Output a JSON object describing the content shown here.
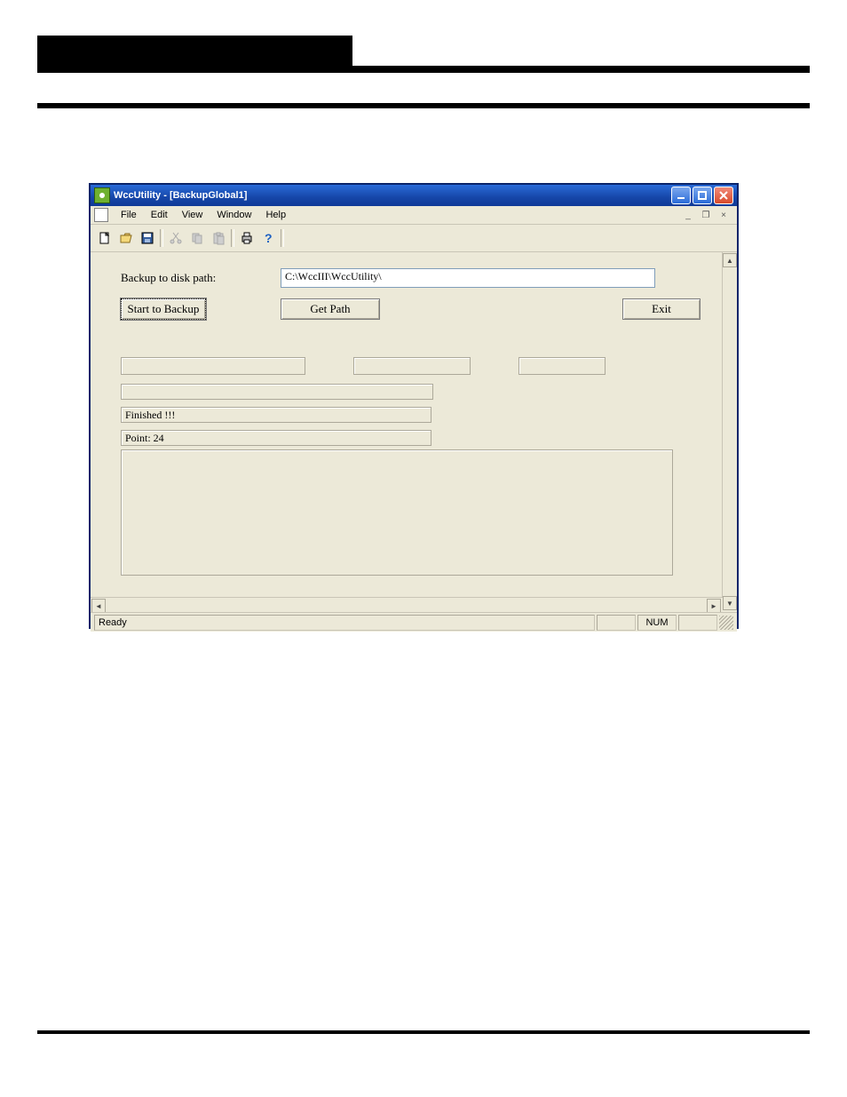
{
  "window": {
    "title": "WccUtility - [BackupGlobal1]",
    "controls": {
      "minimize": "_",
      "maximize": "□",
      "close": "×"
    }
  },
  "menu": {
    "file": "File",
    "edit": "Edit",
    "view": "View",
    "window": "Window",
    "help": "Help"
  },
  "toolbar_icons": [
    "new",
    "open",
    "save",
    "cut",
    "copy",
    "paste",
    "print",
    "help"
  ],
  "form": {
    "path_label": "Backup to disk path:",
    "path_value": "C:\\WccIII\\WccUtility\\",
    "start_button": "Start to Backup",
    "getpath_button": "Get Path",
    "exit_button": "Exit",
    "finished": "Finished !!!",
    "point": "Point: 24"
  },
  "statusbar": {
    "ready": "Ready",
    "num": "NUM"
  }
}
